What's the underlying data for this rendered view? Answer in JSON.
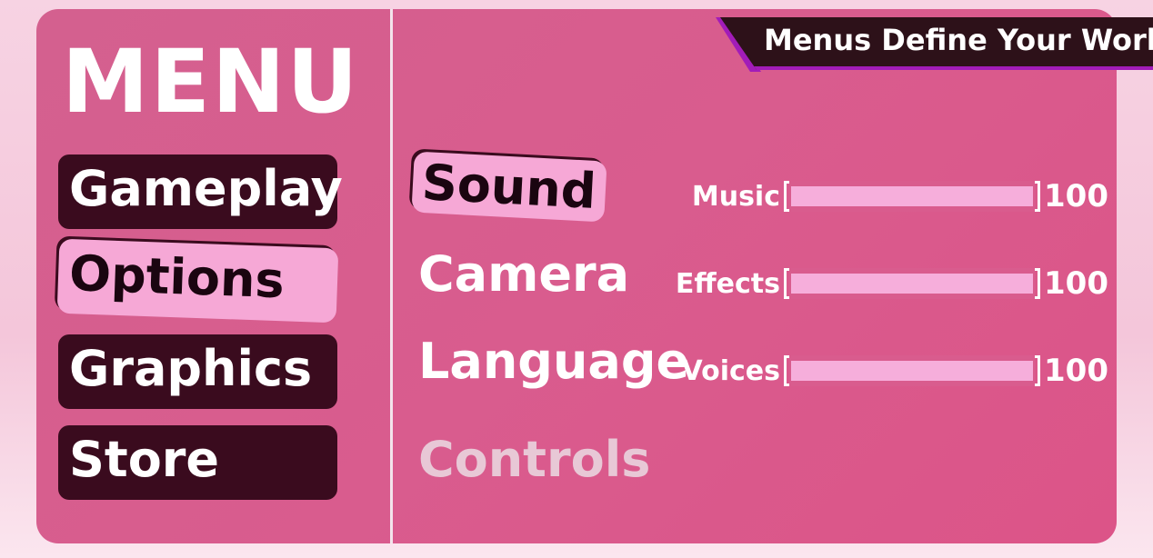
{
  "header": {
    "banner": "Menus Define Your World"
  },
  "menu": {
    "title": "MENU",
    "items": [
      {
        "label": "Gameplay",
        "selected": false
      },
      {
        "label": "Options",
        "selected": true
      },
      {
        "label": "Graphics",
        "selected": false
      },
      {
        "label": "Store",
        "selected": false
      }
    ]
  },
  "options": {
    "tabs": [
      {
        "label": "Sound",
        "selected": true
      },
      {
        "label": "Camera",
        "selected": false
      },
      {
        "label": "Language",
        "selected": false
      },
      {
        "label": "Controls",
        "selected": false,
        "dimmed": true
      }
    ]
  },
  "sound": {
    "sliders": [
      {
        "label": "Music",
        "value": "100",
        "percent": 100
      },
      {
        "label": "Effects",
        "value": "100",
        "percent": 100
      },
      {
        "label": "Voices",
        "value": "100",
        "percent": 100
      }
    ]
  },
  "colors": {
    "panel": "#d95c8e",
    "button_dark": "#3a0b1e",
    "highlight": "#f6a8d6",
    "banner_accent": "#a21cb8"
  }
}
